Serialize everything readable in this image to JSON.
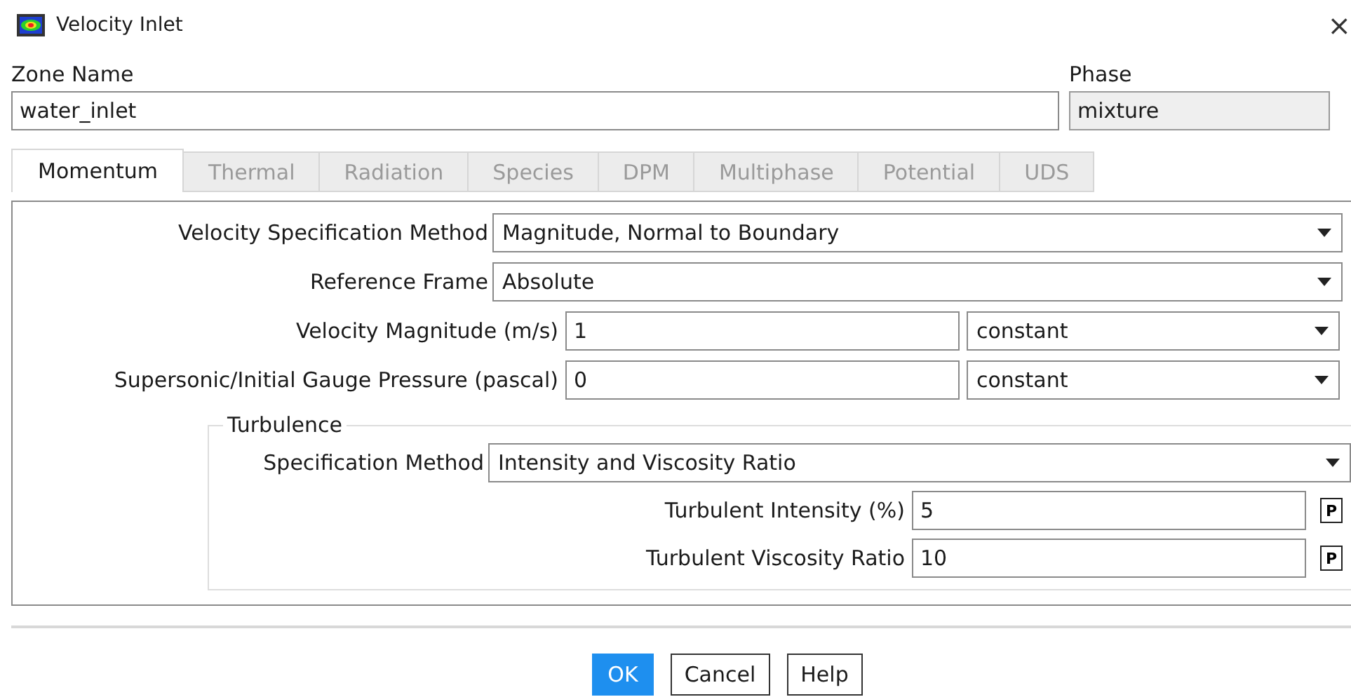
{
  "window": {
    "title": "Velocity Inlet",
    "close": "×"
  },
  "zone_name": {
    "label": "Zone Name",
    "value": "water_inlet"
  },
  "phase": {
    "label": "Phase",
    "value": "mixture",
    "disabled": true
  },
  "tabs": [
    {
      "label": "Momentum",
      "selected": true,
      "disabled": false
    },
    {
      "label": "Thermal",
      "selected": false,
      "disabled": true
    },
    {
      "label": "Radiation",
      "selected": false,
      "disabled": true
    },
    {
      "label": "Species",
      "selected": false,
      "disabled": true
    },
    {
      "label": "DPM",
      "selected": false,
      "disabled": true
    },
    {
      "label": "Multiphase",
      "selected": false,
      "disabled": true
    },
    {
      "label": "Potential",
      "selected": false,
      "disabled": true
    },
    {
      "label": "UDS",
      "selected": false,
      "disabled": true
    }
  ],
  "momentum": {
    "rows": [
      {
        "kind": "dropdown",
        "label": "Velocity Specification Method",
        "value": "Magnitude, Normal to Boundary"
      },
      {
        "kind": "dropdown",
        "label": "Reference Frame",
        "value": "Absolute"
      },
      {
        "kind": "input_dropdown",
        "label": "Velocity Magnitude (m/s)",
        "value": "1",
        "method": "constant"
      },
      {
        "kind": "input_dropdown",
        "label": "Supersonic/Initial Gauge Pressure (pascal)",
        "value": "0",
        "method": "constant"
      }
    ]
  },
  "turbulence": {
    "title": "Turbulence",
    "rows": [
      {
        "kind": "dropdown",
        "label": "Specification Method",
        "value": "Intensity and Viscosity Ratio"
      },
      {
        "kind": "input_param",
        "label": "Turbulent Intensity (%)",
        "value": "5",
        "param": "P"
      },
      {
        "kind": "input_param",
        "label": "Turbulent Viscosity Ratio",
        "value": "10",
        "param": "P"
      }
    ]
  },
  "buttons": [
    {
      "label": "OK",
      "default": true
    },
    {
      "label": "Cancel",
      "default": false
    },
    {
      "label": "Help",
      "default": false
    }
  ]
}
